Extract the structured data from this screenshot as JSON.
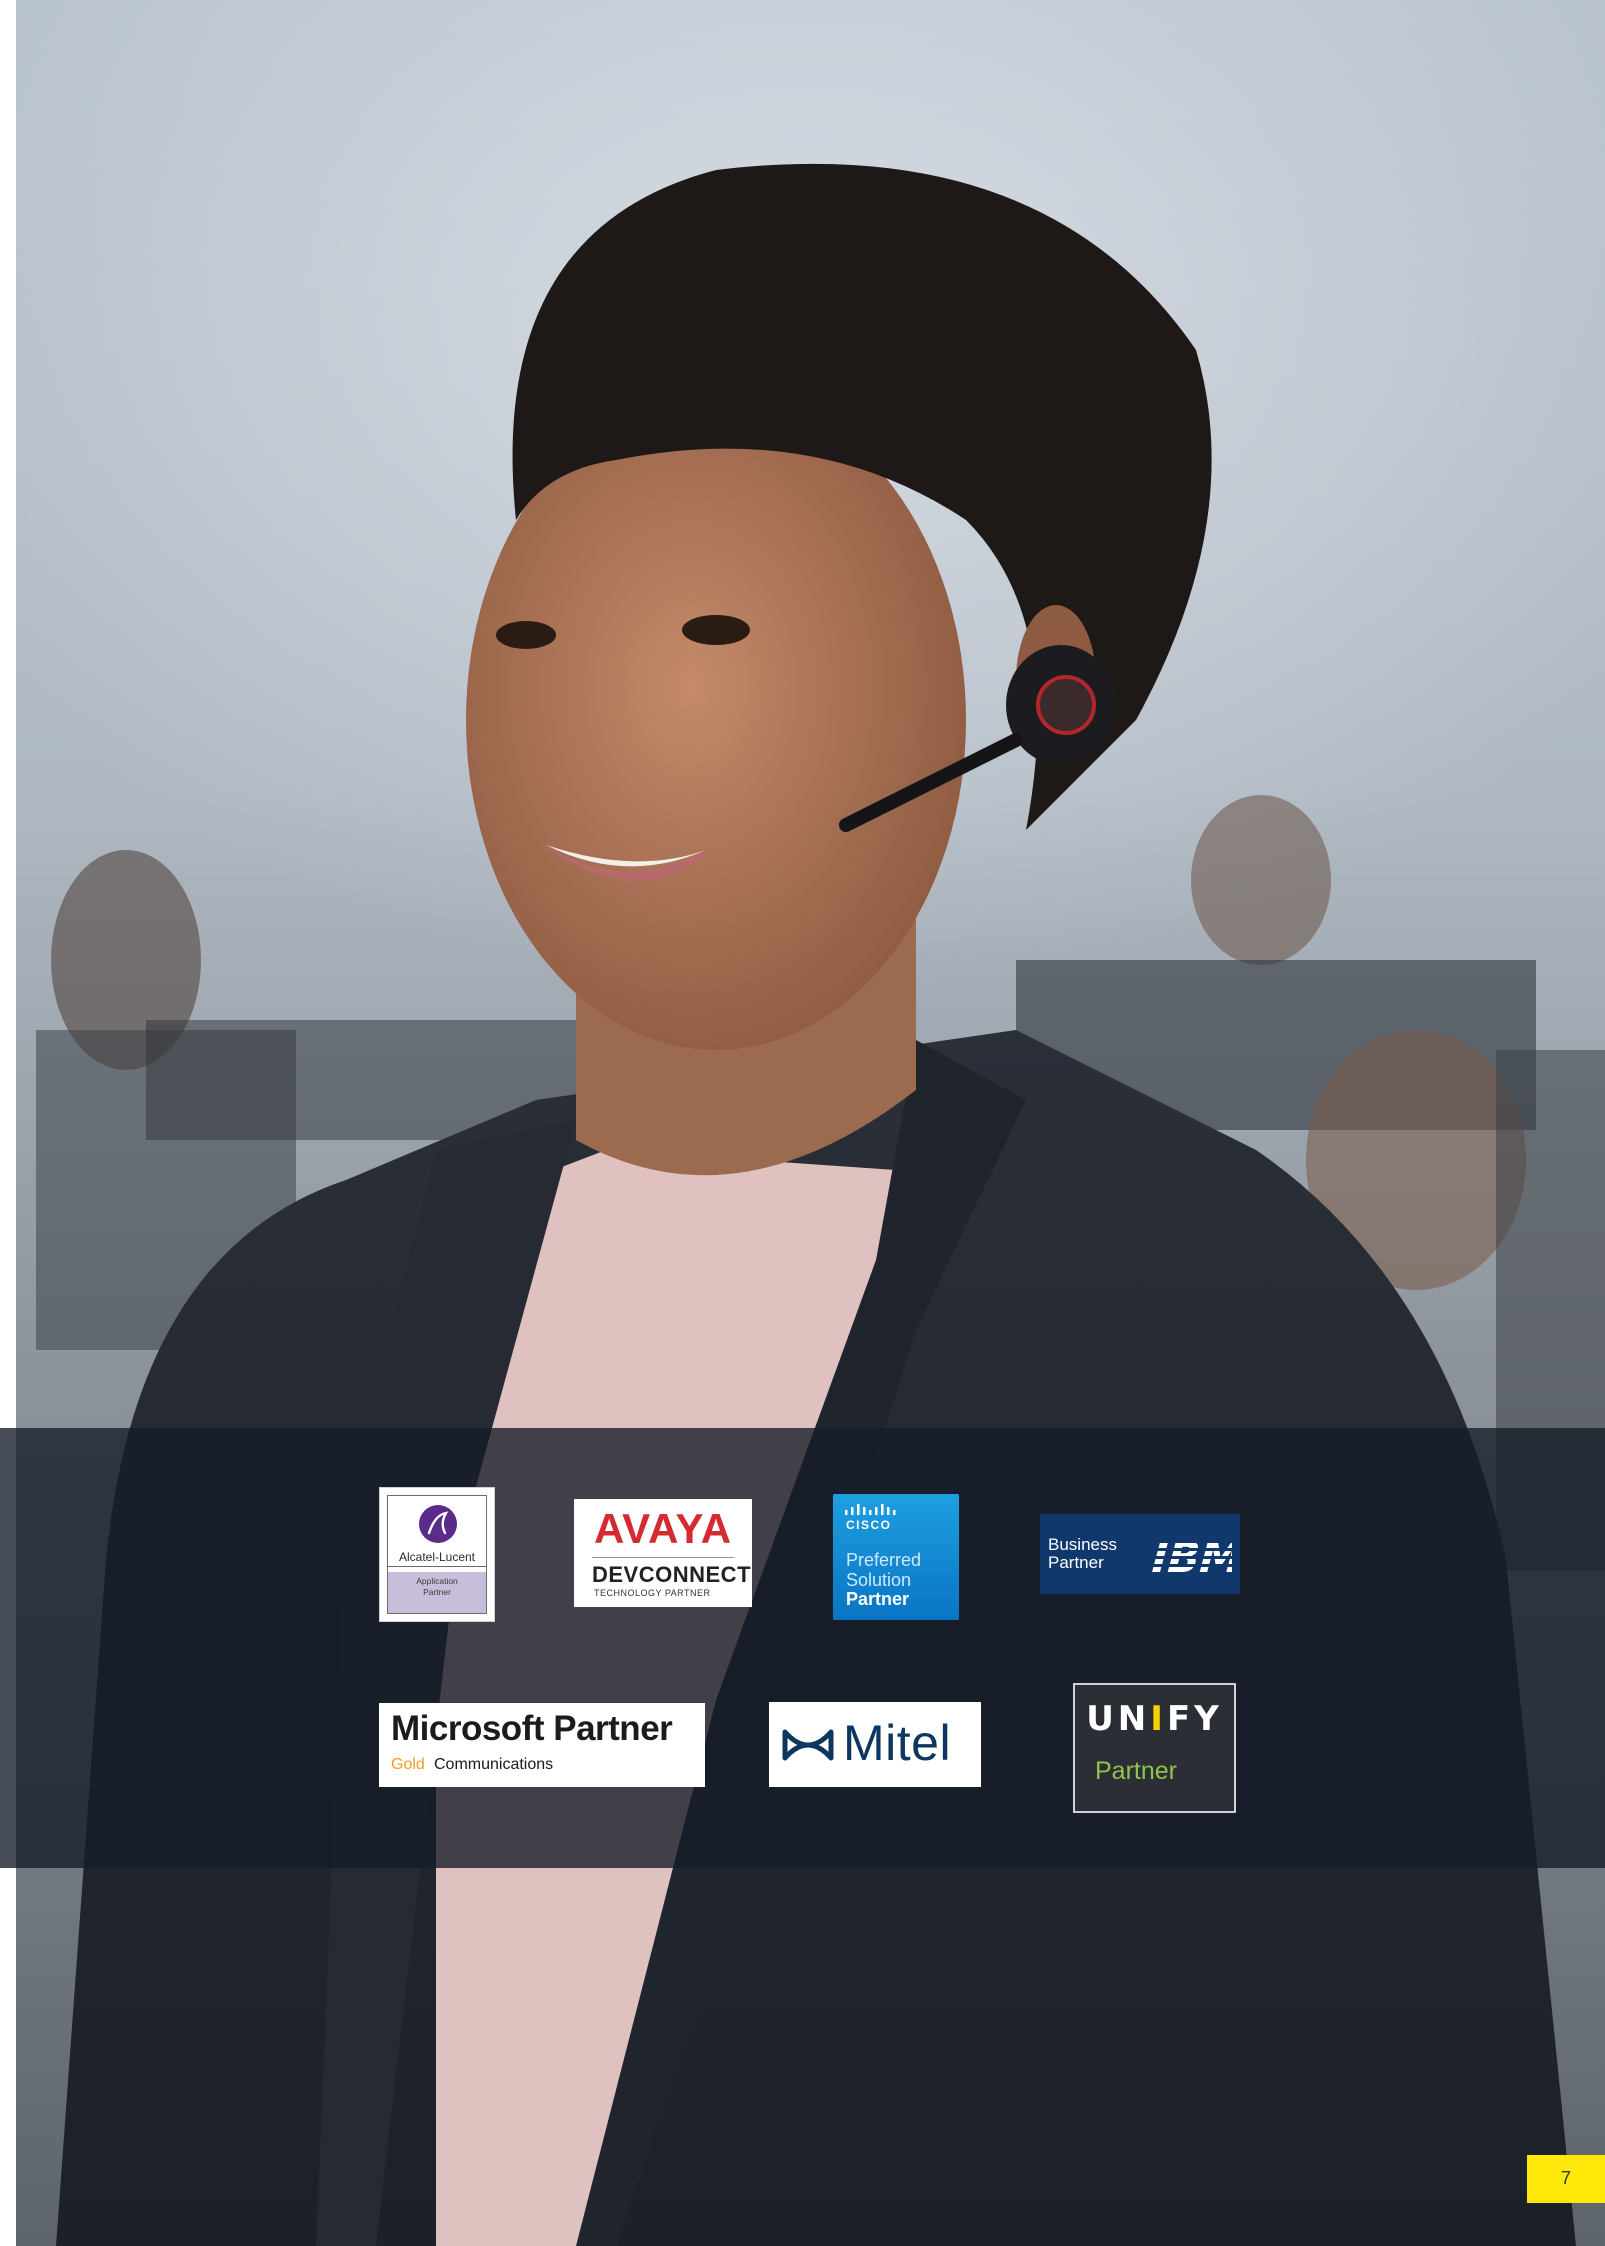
{
  "partner_logos": {
    "alcatel": {
      "name": "Alcatel-Lucent",
      "sub_line1": "Application",
      "sub_line2": "Partner"
    },
    "avaya": {
      "brand": "AVAYA",
      "devconnect": "DEVCONNECT",
      "tagline": "TECHNOLOGY PARTNER"
    },
    "cisco": {
      "wordmark": "CISCO",
      "line1": "Preferred",
      "line2": "Solution",
      "line3": "Partner"
    },
    "ibm": {
      "line1": "Business",
      "line2": "Partner",
      "mark": "IBM"
    },
    "microsoft": {
      "title": "Microsoft Partner",
      "tier": "Gold",
      "competency": "Communications"
    },
    "mitel": {
      "brand": "Mitel"
    },
    "unify": {
      "brand_prefix": "UN",
      "brand_accent": "I",
      "brand_suffix": "FY",
      "partner": "Partner"
    }
  },
  "footer": {
    "page_number": "7"
  },
  "colors": {
    "accent_yellow": "#fde80a",
    "band": "#141c28",
    "avaya_red": "#d42a32",
    "cisco_blue": "#1ea0e0",
    "ibm_blue": "#10386d",
    "unify_green": "#8fc34b"
  }
}
